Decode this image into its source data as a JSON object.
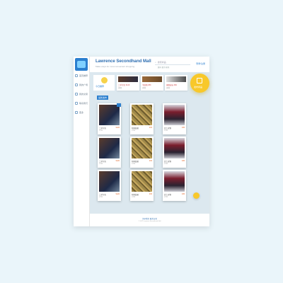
{
  "app": {
    "title": "Lawrence Secondhand Mall",
    "subtitle": "Make ways for most convenient shopping."
  },
  "header": {
    "search_placeholder": "搜索商品",
    "search_tags": "数码  图书  家具",
    "login_label": "登录/注册"
  },
  "sidebar": {
    "items": [
      {
        "label": "首页推荐"
      },
      {
        "label": "我的广场"
      },
      {
        "label": "我的交易"
      },
      {
        "label": "联系我们"
      },
      {
        "label": "更多"
      }
    ]
  },
  "recommend": {
    "label": "今日推荐",
    "cards": [
      {
        "title": "二手包包 ¥120",
        "sub": "详情"
      },
      {
        "title": "书桌椅 ¥80",
        "sub": "详情"
      },
      {
        "title": "键盘鼠标 ¥60",
        "sub": "详情"
      }
    ]
  },
  "post_button": {
    "label": "发布商品"
  },
  "section_title": "最新发布",
  "products": [
    {
      "name": "二手包包",
      "price": "¥120",
      "meta": "3天前",
      "img": "bag"
    },
    {
      "name": "新鲜蔬果",
      "price": "¥15",
      "meta": "3天前",
      "img": "veg"
    },
    {
      "name": "女士衣物",
      "price": "¥45",
      "meta": "3天前",
      "img": "red"
    },
    {
      "name": "二手包包",
      "price": "¥120",
      "meta": "3天前",
      "img": "bag"
    },
    {
      "name": "新鲜蔬果",
      "price": "¥15",
      "meta": "3天前",
      "img": "veg"
    },
    {
      "name": "女士衣物",
      "price": "¥45",
      "meta": "3天前",
      "img": "red"
    },
    {
      "name": "二手包包",
      "price": "¥120",
      "meta": "3天前",
      "img": "bag"
    },
    {
      "name": "新鲜蔬果",
      "price": "¥15",
      "meta": "3天前",
      "img": "veg"
    },
    {
      "name": "女士衣物",
      "price": "¥45",
      "meta": "3天前",
      "img": "red"
    }
  ],
  "pager": {
    "prev": "上一页",
    "next": "下一页"
  },
  "footer": {
    "links": "关于我们   联系方式",
    "copyright": "© 2017 Lawrence Secondhand Mall"
  },
  "colors": {
    "accent": "#2b7fcf",
    "highlight": "#f8c82a",
    "background": "#dce8ef"
  }
}
